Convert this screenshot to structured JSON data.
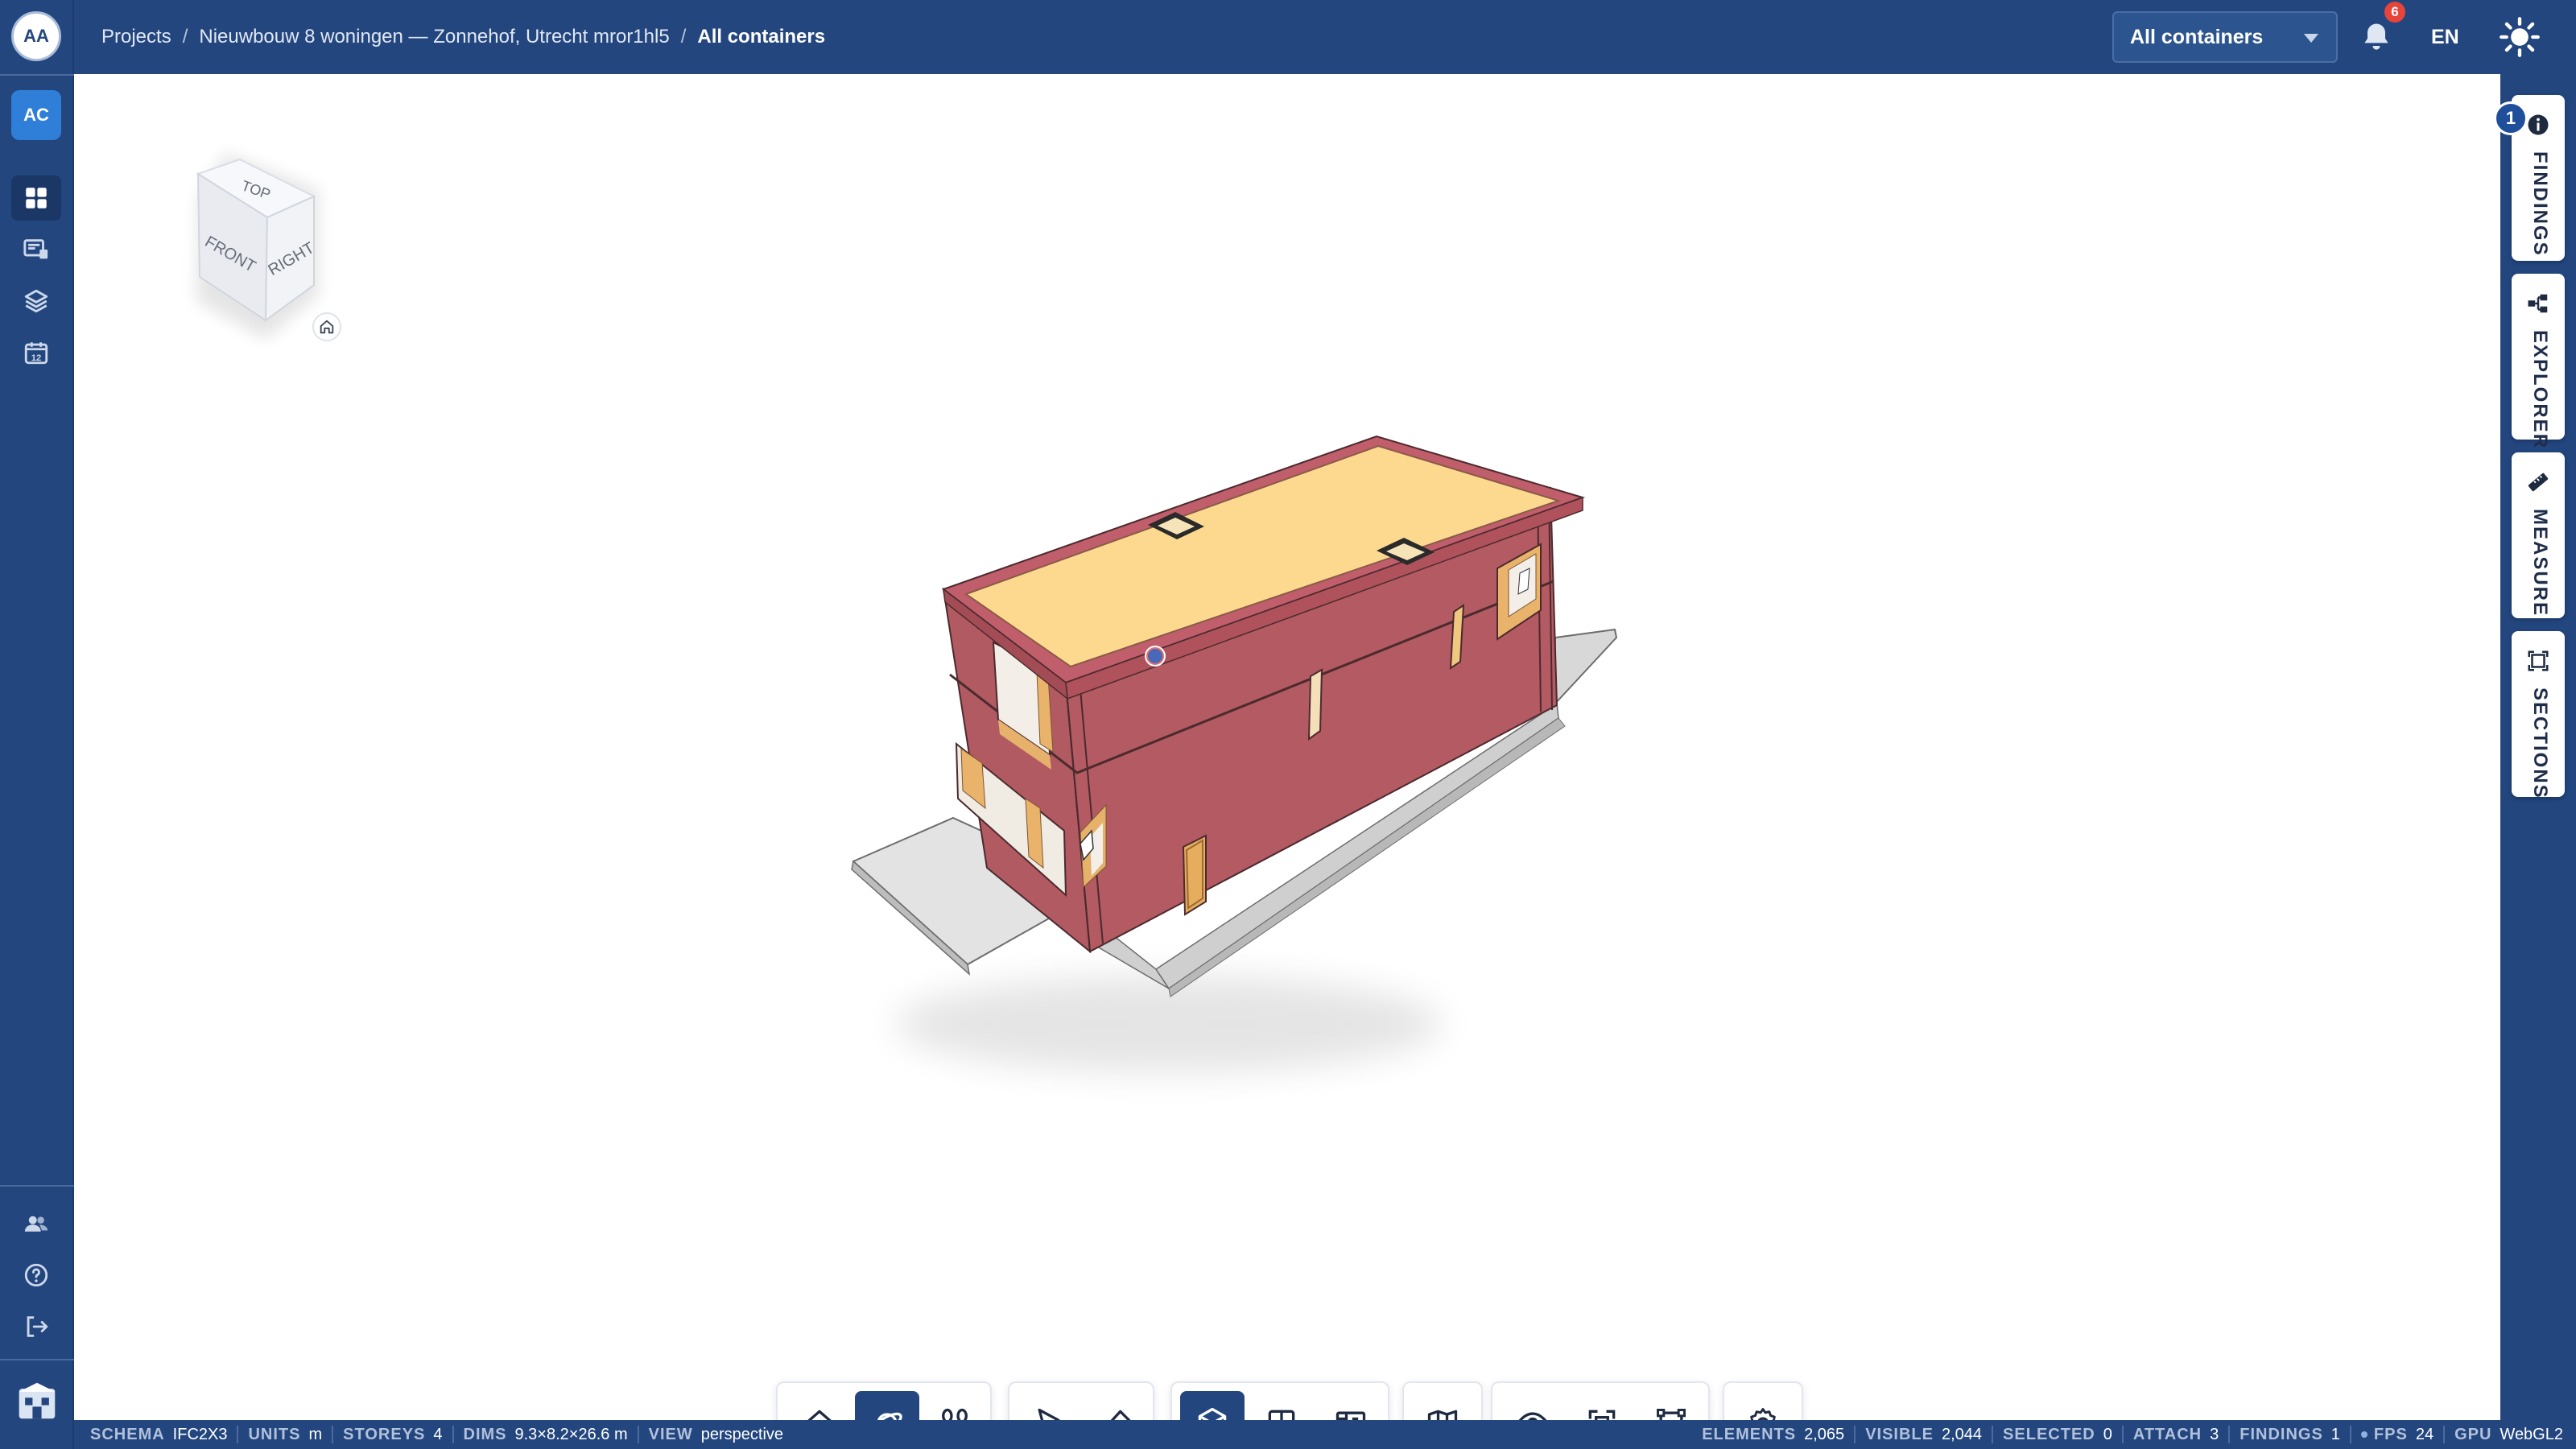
{
  "user": {
    "initials": "AA"
  },
  "org": {
    "initials": "AC"
  },
  "breadcrumb": {
    "root": "Projects",
    "separator": "/",
    "project": "Nieuwbouw 8 woningen — Zonnehof, Utrecht mror1hl5",
    "current": "All containers"
  },
  "header": {
    "container_select": "All containers",
    "notifications_count": "6",
    "language": "EN"
  },
  "side_panels": {
    "findings": {
      "label": "FINDINGS",
      "count": "1",
      "icon": "info-icon"
    },
    "explorer": {
      "label": "EXPLORER",
      "icon": "tree-icon"
    },
    "measure": {
      "label": "MEASURE",
      "icon": "ruler-icon"
    },
    "sections": {
      "label": "SECTIONS",
      "icon": "section-box-icon"
    }
  },
  "navcube": {
    "top": "TOP",
    "front": "FRONT",
    "right": "RIGHT"
  },
  "toolbar": {
    "groups": [
      [
        "home-icon",
        "orbit-icon",
        "walk-icon"
      ],
      [
        "select-icon",
        "eraser-icon"
      ],
      [
        "3d-view-icon",
        "split-view-icon",
        "plan-view-icon"
      ],
      [
        "map-icon"
      ],
      [
        "eye-icon",
        "fit-view-icon",
        "section-box-icon"
      ],
      [
        "settings-icon"
      ]
    ],
    "active": [
      "orbit-icon",
      "3d-view-icon"
    ]
  },
  "status": {
    "schema": {
      "label": "SCHEMA",
      "value": "IFC2X3"
    },
    "units": {
      "label": "UNITS",
      "value": "m"
    },
    "storeys": {
      "label": "STOREYS",
      "value": "4"
    },
    "dims": {
      "label": "DIMS",
      "value": "9.3×8.2×26.6 m"
    },
    "view": {
      "label": "VIEW",
      "value": "perspective"
    },
    "elements": {
      "label": "ELEMENTS",
      "value": "2,065"
    },
    "visible": {
      "label": "VISIBLE",
      "value": "2,044"
    },
    "selected": {
      "label": "SELECTED",
      "value": "0"
    },
    "attach": {
      "label": "ATTACH",
      "value": "3"
    },
    "findings": {
      "label": "FINDINGS",
      "value": "1"
    },
    "fps": {
      "label": "FPS",
      "value": "24"
    },
    "gpu": {
      "label": "GPU",
      "value": "WebGL2"
    }
  },
  "colors": {
    "chrome": "#23467f",
    "accent": "#2f7fd8",
    "wall": "#b35a62",
    "roof": "#fbd995",
    "frame": "#e9b36b",
    "slab": "#e3e3e3"
  }
}
